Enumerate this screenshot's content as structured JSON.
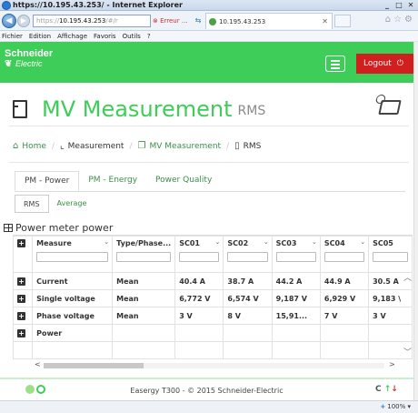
{
  "browser": {
    "title": "https://10.195.43.253/ - Internet Explorer",
    "url_prefix": "https://",
    "url_host": "10.195.43.253",
    "url_suffix": "/#/r",
    "error_tab": "Erreur ...",
    "active_tab": "10.195.43.253",
    "menu": [
      "Fichier",
      "Edition",
      "Affichage",
      "Favoris",
      "Outils",
      "?"
    ],
    "zoom": "100%"
  },
  "header": {
    "brand": "Schneider",
    "brand_sub": "Electric",
    "logout_label": "Logout",
    "accent_color": "#3dcd58"
  },
  "page": {
    "title": "MV Measurement",
    "title_suffix": "RMS"
  },
  "breadcrumb": [
    "Home",
    "Measurement",
    "MV Measurement",
    "RMS"
  ],
  "tabs": [
    "PM - Power",
    "PM - Energy",
    "Power Quality"
  ],
  "subtabs": [
    "RMS",
    "Average"
  ],
  "section_title": "Power meter power",
  "table": {
    "columns": [
      "Measure",
      "Type/Phase...",
      "SC01",
      "SC02",
      "SC03",
      "SC04",
      "SC05"
    ],
    "rows": [
      [
        "Current",
        "Mean",
        "40.4 A",
        "38.7 A",
        "44.2 A",
        "44.9 A",
        "30.5 A"
      ],
      [
        "Single voltage",
        "Mean",
        "6,772 V",
        "6,574 V",
        "9,187 V",
        "6,929 V",
        "9,183 \\"
      ],
      [
        "Phase voltage",
        "Mean",
        "3 V",
        "8 V",
        "15,91...",
        "7 V",
        "3 V"
      ],
      [
        "Power",
        "",
        "",
        "",
        "",
        "",
        ""
      ]
    ]
  },
  "footer": {
    "copyright": "Easergy T300 - © 2015 Schneider-Electric",
    "refresh": "C"
  }
}
